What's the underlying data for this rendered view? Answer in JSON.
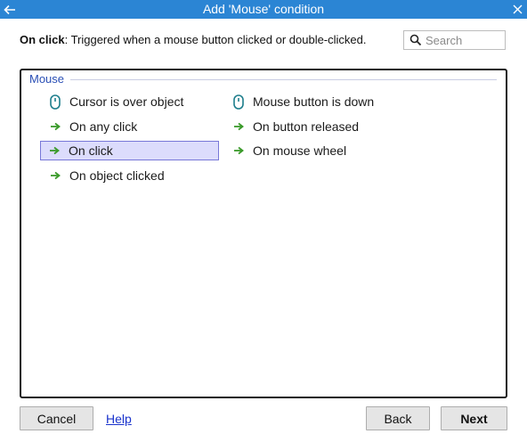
{
  "window": {
    "title": "Add 'Mouse' condition",
    "back_icon": "arrow-left-icon",
    "close_icon": "close-icon",
    "titlebar_color": "#2b85d4"
  },
  "description": {
    "name": "On click",
    "text": ": Triggered when a mouse button clicked or double-clicked."
  },
  "search": {
    "placeholder": "Search",
    "value": ""
  },
  "group": {
    "label": "Mouse",
    "items": [
      {
        "label": "Cursor is over object",
        "icon": "mouse-icon",
        "selected": false
      },
      {
        "label": "Mouse button is down",
        "icon": "mouse-icon",
        "selected": false
      },
      {
        "label": "On any click",
        "icon": "trigger-arrow-icon",
        "selected": false
      },
      {
        "label": "On button released",
        "icon": "trigger-arrow-icon",
        "selected": false
      },
      {
        "label": "On click",
        "icon": "trigger-arrow-icon",
        "selected": true
      },
      {
        "label": "On mouse wheel",
        "icon": "trigger-arrow-icon",
        "selected": false
      },
      {
        "label": "On object clicked",
        "icon": "trigger-arrow-icon",
        "selected": false
      }
    ]
  },
  "buttons": {
    "cancel": "Cancel",
    "help": "Help",
    "back": "Back",
    "next": "Next"
  },
  "colors": {
    "selection_bg": "#dcdcfc",
    "selection_border": "#7878d8",
    "group_label": "#2a4fb5",
    "trigger_arrow": "#3a9a2a",
    "mouse_icon": "#1e7e8c"
  }
}
